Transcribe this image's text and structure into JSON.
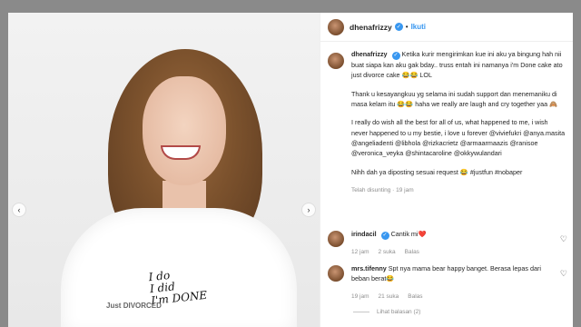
{
  "post": {
    "username": "dhenafrizzy",
    "follow_label": "Ikuti",
    "caption_paragraphs": [
      "Ketika kurir mengirimkan kue ini aku ya bingung hah nii buat siapa kan aku gak bday.. truss entah ini namanya i'm Done cake ato just divorce cake 😂😂 LOL",
      "Thank u kesayangkuu yg selama ini sudah support dan menemaniku di masa kelam itu 😂😂 haha we really are laugh and cry together yaa 🙈",
      "I really do wish all the best for all of us, what happened to me, i wish never happened to u my bestie, i love u forever @viviefukri @anya.masita @angeliadenti @libhola @rizkacrietz @armaarmaazis @ranisoe @veronica_veyka @shintacaroline @okkywulandari",
      "Nihh dah ya diposting sesuai request 😂 #justfun #nobaper"
    ],
    "edited_label": "Telah disunting · 19 jam"
  },
  "image": {
    "cake_lines": [
      "I do",
      "I did",
      "I'm DONE"
    ],
    "cake_small": "Just",
    "cake_stamp": "DIVORCED"
  },
  "comments": [
    {
      "username": "irindacil",
      "verified": true,
      "text": "Cantik mi❤️",
      "time": "12 jam",
      "likes": "2 suka",
      "reply": "Balas"
    },
    {
      "username": "mrs.tifenny",
      "verified": false,
      "text": "Spt nya mama bear happy banget. Berasa lepas dari beban berat😂",
      "time": "19 jam",
      "likes": "21 suka",
      "reply": "Balas",
      "view_replies": "Lihat balasan (2)"
    }
  ],
  "icons": {
    "prev": "chevron-left-icon",
    "next": "chevron-right-icon",
    "like": "heart-icon",
    "verified": "verified-badge-icon"
  },
  "colors": {
    "link": "#00376b",
    "accent": "#3897f0",
    "muted": "#8e8e8e"
  }
}
